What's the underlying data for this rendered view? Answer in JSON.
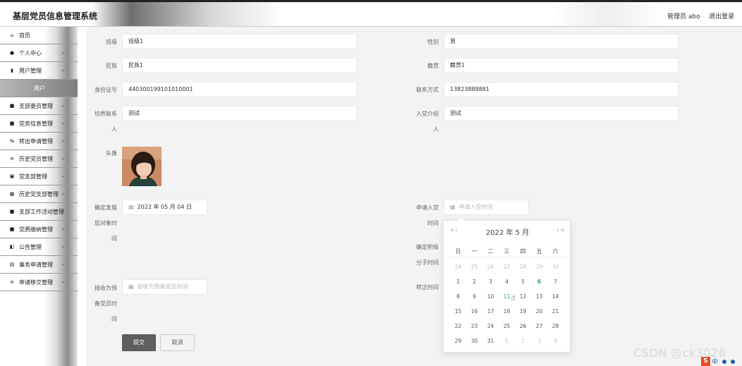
{
  "header": {
    "title": "基层党员信息管理系统",
    "user": "管理员 abo",
    "logout": "退出登录"
  },
  "sidebar": {
    "items": [
      {
        "icon": "home-icon",
        "glyph": "⌂",
        "label": "首页",
        "chevron": false
      },
      {
        "icon": "person-icon",
        "glyph": "●",
        "label": "个人中心",
        "chevron": true
      },
      {
        "icon": "bar-chart-icon",
        "glyph": "▮",
        "label": "用户管理",
        "chevron": true
      },
      {
        "icon": "",
        "glyph": "",
        "label": "用户",
        "chevron": false,
        "active": true
      },
      {
        "icon": "grid-icon",
        "glyph": "■",
        "label": "支部委员管理",
        "chevron": true
      },
      {
        "icon": "folder-icon",
        "glyph": "■",
        "label": "党务信息管理",
        "chevron": true
      },
      {
        "icon": "transfer-icon",
        "glyph": "⇆",
        "label": "转出申请管理",
        "chevron": true
      },
      {
        "icon": "list-icon",
        "glyph": "≡",
        "label": "历史党员管理",
        "chevron": true
      },
      {
        "icon": "image-icon",
        "glyph": "▣",
        "label": "党支部管理",
        "chevron": true
      },
      {
        "icon": "grid-icon",
        "glyph": "▦",
        "label": "历史党支部管理",
        "chevron": true
      },
      {
        "icon": "grid-icon",
        "glyph": "■",
        "label": "支部工作活动管理",
        "chevron": true
      },
      {
        "icon": "grid-icon",
        "glyph": "■",
        "label": "党费缴纳管理",
        "chevron": true
      },
      {
        "icon": "announce-icon",
        "glyph": "◧",
        "label": "公告管理",
        "chevron": true
      },
      {
        "icon": "document-icon",
        "glyph": "▤",
        "label": "事务申请管理",
        "chevron": true
      },
      {
        "icon": "list-icon",
        "glyph": "≡",
        "label": "申请移交管理",
        "chevron": true
      }
    ]
  },
  "form": {
    "class_label": "班级",
    "class_value": "班级1",
    "gender_label": "性别",
    "gender_value": "男",
    "ethnic_label": "民族",
    "ethnic_value": "民族1",
    "native_label": "籍贯",
    "native_value": "籍贯1",
    "id_label": "身份证号",
    "id_value": "440300199101010001",
    "phone_label": "联系方式",
    "phone_value": "13823888881",
    "trainer_label_1": "培养联系",
    "trainer_label_2": "人",
    "trainer_value": "测试",
    "introducer_label_1": "入党介绍",
    "introducer_label_2": "人",
    "introducer_value": "测试",
    "avatar_label": "头像",
    "dev_label_1": "确定发展",
    "dev_label_2": "层对象时",
    "dev_label_3": "间",
    "dev_value": "2022 年 05 月 04 日",
    "apply_label_1": "申请入党",
    "apply_label_2": "时间",
    "apply_placeholder": "申请入党时间",
    "active_label_1": "确定积极",
    "active_label_2": "分子时间",
    "prob_label_1": "接收为预",
    "prob_label_2": "备党员时",
    "prob_label_3": "间",
    "prob_placeholder": "接收为预备党员时间",
    "note_label": "转正时间",
    "submit": "提交",
    "cancel": "取消"
  },
  "datepicker": {
    "prev_year": "«",
    "prev_month": "‹",
    "next_month": "›",
    "next_year": "»",
    "header": "2022 年  5 月",
    "weekdays": [
      "日",
      "一",
      "二",
      "三",
      "四",
      "五",
      "六"
    ],
    "weeks": [
      [
        "24",
        "25",
        "26",
        "27",
        "28",
        "29",
        "30"
      ],
      [
        "1",
        "2",
        "3",
        "4",
        "5",
        "6",
        "7"
      ],
      [
        "8",
        "9",
        "10",
        "11",
        "12",
        "13",
        "14"
      ],
      [
        "15",
        "16",
        "17",
        "18",
        "19",
        "20",
        "21"
      ],
      [
        "22",
        "23",
        "24",
        "25",
        "26",
        "27",
        "28"
      ],
      [
        "29",
        "30",
        "31",
        "1",
        "2",
        "3",
        "4"
      ]
    ],
    "today": "6",
    "hovered": "11"
  },
  "watermark": "CSDN @ck3026",
  "tray": {
    "ime": "中"
  },
  "colors": {
    "accent": "#2aa37a",
    "submit_bg": "#5e5e5e",
    "content_bg": "#f3f3f3"
  }
}
